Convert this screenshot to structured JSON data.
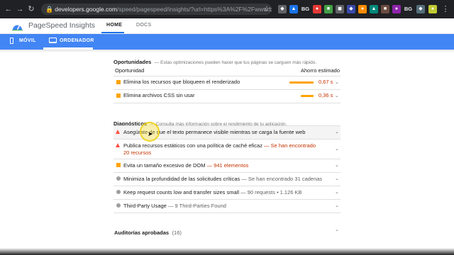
{
  "browser": {
    "url_host": "developers.google.com",
    "url_path": "/speed/pagespeed/insights/?url=https%3A%2F%2Fwww.borjagiron.com&tab=d...",
    "ext_label_1": "BG",
    "ext_label_2": "BG"
  },
  "header": {
    "app_title": "PageSpeed Insights",
    "tab_home": "HOME",
    "tab_docs": "DOCS"
  },
  "device_bar": {
    "mobile": "MÓVIL",
    "desktop": "ORDENADOR"
  },
  "opportunities": {
    "title": "Oportunidades",
    "subtitle": "— Estas optimizaciones pueden hacer que tus páginas se carguen más rápido.",
    "col_opportunity": "Oportunidad",
    "col_savings": "Ahorro estimado",
    "items": [
      {
        "label": "Elimina los recursos que bloqueen el renderizado",
        "savings": "0,67 s",
        "savings_value": 0.67
      },
      {
        "label": "Elimina archivos CSS sin usar",
        "savings": "0,36 s",
        "savings_value": 0.36
      }
    ]
  },
  "diagnostics": {
    "title": "Diagnósticos",
    "subtitle": "— Consulta más información sobre el rendimiento de tu aplicación.",
    "items": [
      {
        "label": "Asegúrate de que el texto permanece visible mientras se carga la fuente web",
        "detail": "",
        "severity": "fail"
      },
      {
        "label": "Publica recursos estáticos con una política de caché eficaz",
        "detail": "— Se han encontrado",
        "detail2": "20 recursos",
        "severity": "fail"
      },
      {
        "label": "Evita un tamaño excesivo de DOM",
        "detail": "— 941 elementos",
        "severity": "average"
      },
      {
        "label": "Minimiza la profundidad de las solicitudes críticas",
        "detail": "— Se han encontrado 31 cadenas",
        "severity": "info"
      },
      {
        "label": "Keep request counts low and transfer sizes small",
        "detail": "— 90 requests • 1.126 KB",
        "severity": "info"
      },
      {
        "label": "Third-Party Usage",
        "detail": "— 9 Third-Parties Found",
        "severity": "info"
      }
    ]
  },
  "passed": {
    "title": "Auditorías aprobadas",
    "count": "(16)"
  },
  "colors": {
    "accent_blue": "#4285f4",
    "fail_red": "#ff4e42",
    "average_orange": "#ffa400",
    "info_gray": "#9e9e9e"
  }
}
